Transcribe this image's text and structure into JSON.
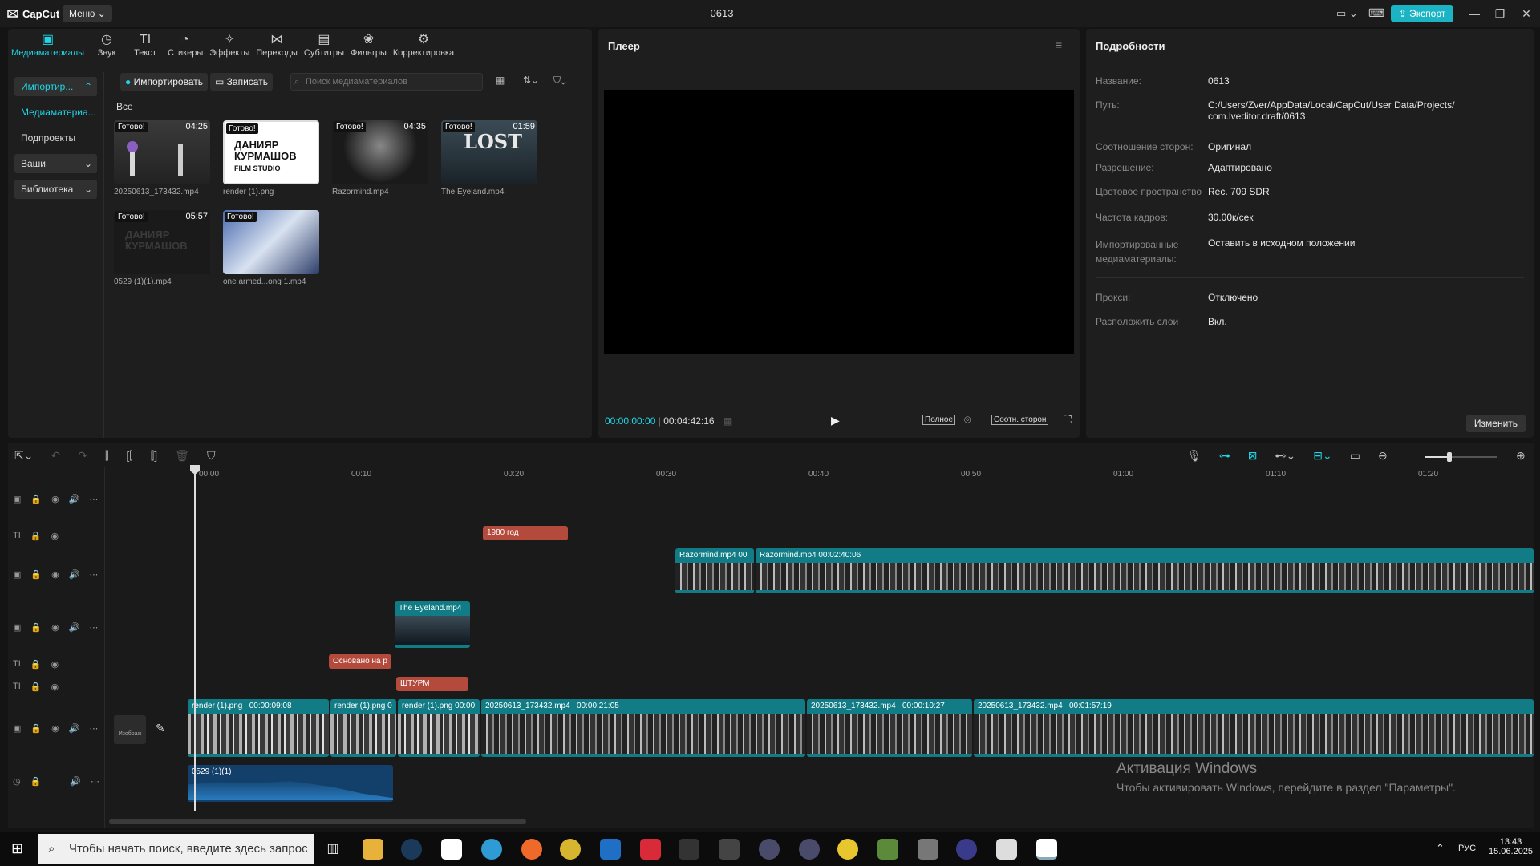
{
  "titlebar": {
    "app_name": "CapCut",
    "menu_label": "Меню",
    "project_title": "0613",
    "export_label": "Экспорт",
    "minimize_icon": "minimize-icon",
    "maximize_icon": "restore-icon",
    "close_icon": "close-icon"
  },
  "toolbar": {
    "tabs": [
      {
        "label": "Медиаматериалы",
        "icon": "media-icon",
        "active": true
      },
      {
        "label": "Звук",
        "icon": "audio-icon"
      },
      {
        "label": "Текст",
        "icon": "text-icon"
      },
      {
        "label": "Стикеры",
        "icon": "sticker-icon"
      },
      {
        "label": "Эффекты",
        "icon": "effects-icon"
      },
      {
        "label": "Переходы",
        "icon": "transitions-icon"
      },
      {
        "label": "Субтитры",
        "icon": "subtitles-icon"
      },
      {
        "label": "Фильтры",
        "icon": "filters-icon"
      },
      {
        "label": "Корректировка",
        "icon": "adjust-icon"
      }
    ]
  },
  "sidebar": {
    "items": [
      {
        "label": "Импортир..."
      },
      {
        "label": "Медиаматериа..."
      },
      {
        "label": "Подпроекты"
      },
      {
        "label": "Ваши"
      },
      {
        "label": "Библиотека"
      }
    ]
  },
  "media": {
    "import_label": "Импортировать",
    "record_label": "Записать",
    "search_placeholder": "Поиск медиаматериалов",
    "all_label": "Все",
    "items": [
      {
        "name": "20250613_173432.mp4",
        "status": "Готово!",
        "duration": "04:25"
      },
      {
        "name": "render (1).png",
        "status": "Готово!",
        "duration": ""
      },
      {
        "name": "Razormind.mp4",
        "status": "Готово!",
        "duration": "04:35"
      },
      {
        "name": "The Eyeland.mp4",
        "status": "Готово!",
        "duration": "01:59"
      },
      {
        "name": "0529 (1)(1).mp4",
        "status": "Готово!",
        "duration": "05:57"
      },
      {
        "name": "one armed...ong 1.mp4",
        "status": "Готово!",
        "duration": ""
      }
    ],
    "thumb_texts": {
      "studio_line1": "ДАНИЯР",
      "studio_line2": "КУРМАШОВ",
      "studio_line3": "FILM STUDIO",
      "lost": "LOST"
    }
  },
  "player": {
    "title": "Плеер",
    "current_time": "00:00:00:00",
    "total_time": "00:04:42:16",
    "full_label": "Полное",
    "ratio_label": "Соотн. сторон"
  },
  "details": {
    "title": "Подробности",
    "rows": [
      {
        "label": "Название:",
        "value": "0613"
      },
      {
        "label": "Путь:",
        "value": "C:/Users/Zver/AppData/Local/CapCut/User Data/Projects/ com.lveditor.draft/0613"
      },
      {
        "label": "Соотношение сторон:",
        "value": "Оригинал"
      },
      {
        "label": "Разрешение:",
        "value": "Адаптировано"
      },
      {
        "label": "Цветовое пространство",
        "value": "Rec. 709 SDR"
      },
      {
        "label": "Частота кадров:",
        "value": "30.00к/сек"
      },
      {
        "label": "Импортированные медиаматериалы:",
        "value": "Оставить в исходном положении"
      },
      {
        "label": "Прокси:",
        "value": "Отключено"
      },
      {
        "label": "Расположить слои",
        "value": "Вкл."
      }
    ],
    "edit_label": "Изменить"
  },
  "timeline": {
    "ruler": [
      "00:00",
      "00:10",
      "00:20",
      "00:30",
      "00:40",
      "00:50",
      "01:00",
      "01:10",
      "01:20"
    ],
    "cover_label": "Изображ",
    "clips": {
      "text_1980": "1980 год",
      "razormind_a": "Razormind.mp4",
      "razormind_a_time": "00",
      "razormind_b": "Razormind.mp4",
      "razormind_b_time": "00:02:40:06",
      "eyeland": "The Eyeland.mp4",
      "text_based": "Основано на р",
      "text_shturm": "ШТУРМ",
      "render_1": "render (1).png",
      "render_1_time": "00:00:09:08",
      "render_2": "render (1).png",
      "render_2_time": "0",
      "render_3": "render (1).png",
      "render_3_time": "00:00",
      "main_1": "20250613_173432.mp4",
      "main_1_time": "00:00:21:05",
      "main_2": "20250613_173432.mp4",
      "main_2_time": "00:00:10:27",
      "main_3": "20250613_173432.mp4",
      "main_3_time": "00:01:57:19",
      "audio": "0529 (1)(1)"
    }
  },
  "watermark": {
    "line1": "Активация Windows",
    "line2": "Чтобы активировать Windows, перейдите в раздел \"Параметры\"."
  },
  "taskbar": {
    "search_placeholder": "Чтобы начать поиск, введите здесь запрос",
    "lang": "РУС",
    "time": "13:43",
    "date": "15.06.2025"
  },
  "colors": {
    "accent": "#1fd5e6",
    "export": "#1ab4c4",
    "video_clip": "#117b86",
    "text_clip": "#b44a3c"
  }
}
